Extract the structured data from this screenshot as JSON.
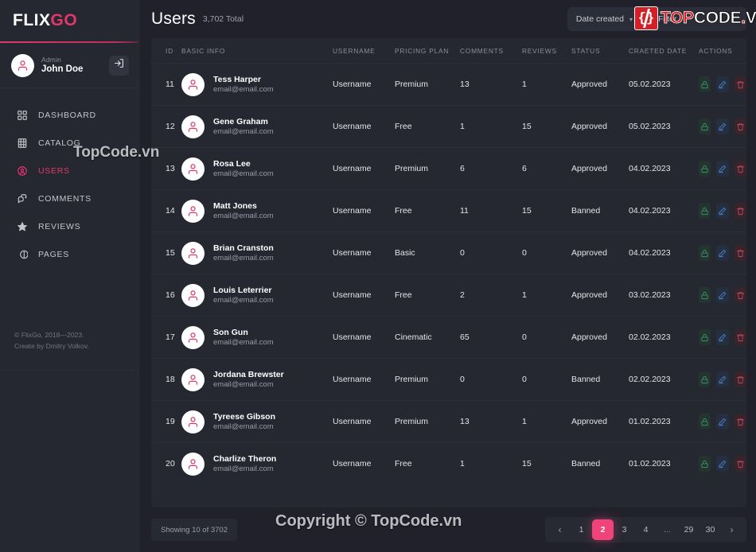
{
  "brand": {
    "first": "FLIX",
    "second": "GO"
  },
  "profile": {
    "role": "Admin",
    "name": "John Doe",
    "logout_icon": "logout-icon"
  },
  "sidebar": {
    "items": [
      {
        "label": "DASHBOARD",
        "icon": "grid-icon",
        "active": false
      },
      {
        "label": "CATALOG",
        "icon": "film-icon",
        "active": false
      },
      {
        "label": "USERS",
        "icon": "user-circle-icon",
        "active": true
      },
      {
        "label": "COMMENTS",
        "icon": "comments-icon",
        "active": false
      },
      {
        "label": "REVIEWS",
        "icon": "star-icon",
        "active": false
      },
      {
        "label": "PAGES",
        "icon": "pages-icon",
        "active": false
      }
    ],
    "footer_line1": "© FlixGo, 2018—2023.",
    "footer_line2": "Create by Dmitry Volkov."
  },
  "header": {
    "title": "Users",
    "count": "3,702 Total",
    "sort_label": "Date created",
    "sort_caret": "chevron-down-icon",
    "filter_label": "Filter"
  },
  "table": {
    "columns": [
      "ID",
      "BASIC INFO",
      "USERNAME",
      "PRICING PLAN",
      "COMMENTS",
      "REVIEWS",
      "STATUS",
      "CRAETED DATE",
      "ACTIONS"
    ],
    "actions": [
      {
        "name": "lock-icon",
        "title": "Lock"
      },
      {
        "name": "edit-icon",
        "title": "Edit"
      },
      {
        "name": "trash-icon",
        "title": "Delete"
      }
    ],
    "rows": [
      {
        "id": "11",
        "name": "Tess Harper",
        "email": "email@email.com",
        "username": "Username",
        "plan": "Premium",
        "comments": "13",
        "reviews": "1",
        "status": "Approved",
        "date": "05.02.2023"
      },
      {
        "id": "12",
        "name": "Gene Graham",
        "email": "email@email.com",
        "username": "Username",
        "plan": "Free",
        "comments": "1",
        "reviews": "15",
        "status": "Approved",
        "date": "05.02.2023"
      },
      {
        "id": "13",
        "name": "Rosa Lee",
        "email": "email@email.com",
        "username": "Username",
        "plan": "Premium",
        "comments": "6",
        "reviews": "6",
        "status": "Approved",
        "date": "04.02.2023"
      },
      {
        "id": "14",
        "name": "Matt Jones",
        "email": "email@email.com",
        "username": "Username",
        "plan": "Free",
        "comments": "11",
        "reviews": "15",
        "status": "Banned",
        "date": "04.02.2023"
      },
      {
        "id": "15",
        "name": "Brian Cranston",
        "email": "email@email.com",
        "username": "Username",
        "plan": "Basic",
        "comments": "0",
        "reviews": "0",
        "status": "Approved",
        "date": "04.02.2023"
      },
      {
        "id": "16",
        "name": "Louis Leterrier",
        "email": "email@email.com",
        "username": "Username",
        "plan": "Free",
        "comments": "2",
        "reviews": "1",
        "status": "Approved",
        "date": "03.02.2023"
      },
      {
        "id": "17",
        "name": "Son Gun",
        "email": "email@email.com",
        "username": "Username",
        "plan": "Cinematic",
        "comments": "65",
        "reviews": "0",
        "status": "Approved",
        "date": "02.02.2023"
      },
      {
        "id": "18",
        "name": "Jordana Brewster",
        "email": "email@email.com",
        "username": "Username",
        "plan": "Premium",
        "comments": "0",
        "reviews": "0",
        "status": "Banned",
        "date": "02.02.2023"
      },
      {
        "id": "19",
        "name": "Tyreese Gibson",
        "email": "email@email.com",
        "username": "Username",
        "plan": "Premium",
        "comments": "13",
        "reviews": "1",
        "status": "Approved",
        "date": "01.02.2023"
      },
      {
        "id": "20",
        "name": "Charlize Theron",
        "email": "email@email.com",
        "username": "Username",
        "plan": "Free",
        "comments": "1",
        "reviews": "15",
        "status": "Banned",
        "date": "01.02.2023"
      }
    ]
  },
  "footer": {
    "showing": "Showing 10 of 3702",
    "pagination": {
      "prev": "‹",
      "next": "›",
      "pages": [
        "1",
        "2",
        "3",
        "4",
        "...",
        "29",
        "30"
      ],
      "active": "2"
    }
  },
  "watermarks": {
    "sidebar": "TopCode.vn",
    "bottom": "Copyright © TopCode.vn",
    "logo_top": "TOP",
    "logo_code": "CODE",
    "logo_dot": ".",
    "logo_vn": "VN"
  },
  "colors": {
    "accent": "#e2376a",
    "accent_bright": "#f0437a",
    "approved": "#2e9e7b",
    "banned": "#c94a5d",
    "bg": "#21212b",
    "panel": "#252830"
  }
}
